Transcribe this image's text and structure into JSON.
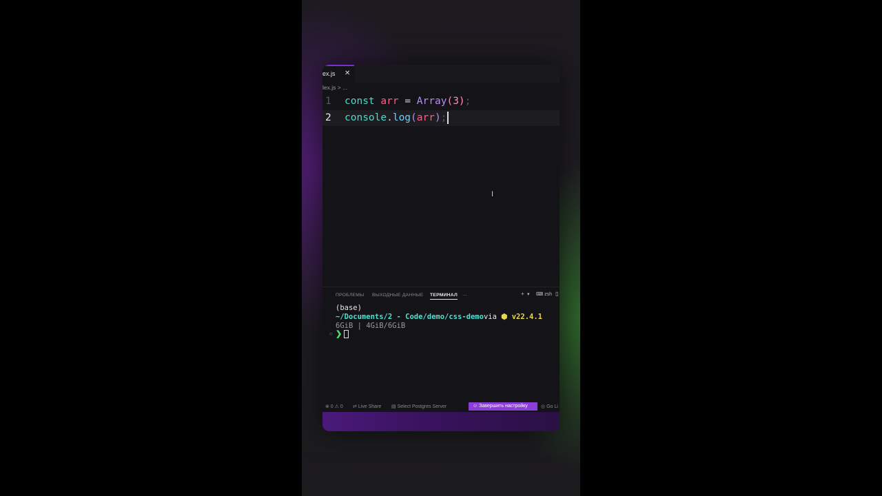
{
  "editor_tab": {
    "name": "ex.js",
    "close": "✕"
  },
  "breadcrumb": {
    "file": "lex.js",
    "sep": ">",
    "more": "..."
  },
  "code": {
    "line1": {
      "num": "1",
      "t1": "const",
      "t2": " ",
      "t3": "arr",
      "t4": " = ",
      "t5": "Array",
      "t6": "(",
      "t7": "3",
      "t8": ")",
      "t9": ";"
    },
    "line2": {
      "num": "2",
      "t1": "console",
      "t2": ".",
      "t3": "log",
      "t4": "(",
      "t5": "arr",
      "t6": ")",
      "t7": ";"
    }
  },
  "panel": {
    "tabs": [
      "ПРОБЛЕМЫ",
      "ВЫХОДНЫЕ ДАННЫЕ",
      "ТЕРМИНАЛ"
    ],
    "more": "···",
    "add": "+",
    "shell": "zsh"
  },
  "terminal": {
    "line1": "(base)",
    "path": "~/Documents/2 - Code/demo/css-demo",
    "via": "via",
    "node_icon": "⬢",
    "node_version": "v22.4.1",
    "mem": "6GiB | 4GiB/6GiB",
    "prompt_dot": "○",
    "prompt_arrow": "❯"
  },
  "statusbar": {
    "errors": "⊗ 0 ⚠ 0",
    "live_share": "Live Share",
    "postgres": "Select Postgres Server",
    "setup": "Завершить настройку",
    "go_live": "Go Li"
  }
}
